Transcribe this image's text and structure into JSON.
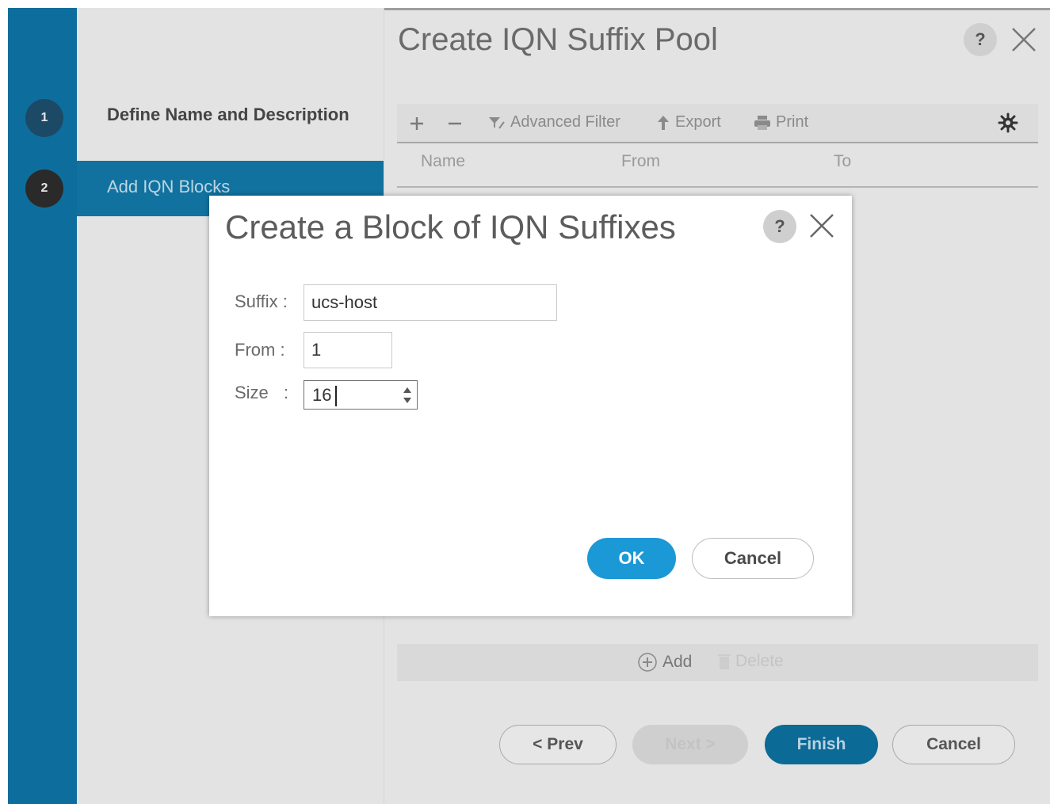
{
  "wizard": {
    "title": "Create IQN Suffix Pool",
    "help_label": "?",
    "steps": [
      {
        "number": "1",
        "label": "Define Name and Description"
      },
      {
        "number": "2",
        "label": "Add IQN Blocks"
      }
    ],
    "toolbar": {
      "advanced_filter": "Advanced Filter",
      "export": "Export",
      "print": "Print"
    },
    "table_columns": [
      "Name",
      "From",
      "To"
    ],
    "add_label": "Add",
    "delete_label": "Delete",
    "buttons": {
      "prev": "< Prev",
      "next": "Next >",
      "finish": "Finish",
      "cancel": "Cancel"
    }
  },
  "modal": {
    "title": "Create a Block of IQN Suffixes",
    "help_label": "?",
    "fields": {
      "suffix_label": "Suffix :",
      "suffix_value": "ucs-host",
      "from_label": "From :",
      "from_value": "1",
      "size_label": "Size",
      "size_colon": ":",
      "size_value": "16"
    },
    "ok_label": "OK",
    "cancel_label": "Cancel"
  },
  "colors": {
    "rail": "#0d6e9e",
    "active_step": "#11729f",
    "ok_button": "#1b98d6",
    "finish_button": "#0b6a96"
  }
}
